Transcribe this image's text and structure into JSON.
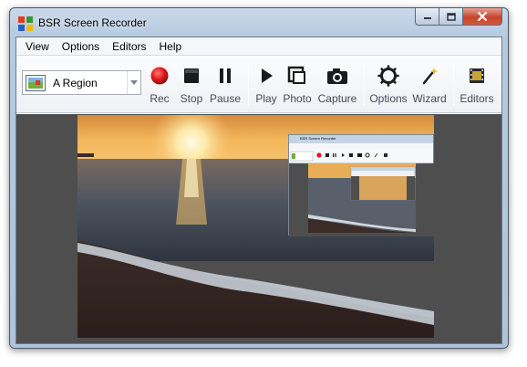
{
  "window": {
    "title": "BSR Screen Recorder"
  },
  "menu": [
    {
      "label": "View"
    },
    {
      "label": "Options"
    },
    {
      "label": "Editors"
    },
    {
      "label": "Help"
    }
  ],
  "region_select": {
    "value": "A Region",
    "icon": "region-icon"
  },
  "toolbar": {
    "rec": {
      "label": "Rec",
      "icon": "record-icon",
      "color": "#e11a1a"
    },
    "stop": {
      "label": "Stop",
      "icon": "stop-icon"
    },
    "pause": {
      "label": "Pause",
      "icon": "pause-icon"
    },
    "play": {
      "label": "Play",
      "icon": "play-icon"
    },
    "photo": {
      "label": "Photo",
      "icon": "photo-icon"
    },
    "capture": {
      "label": "Capture",
      "icon": "camera-icon"
    },
    "options": {
      "label": "Options",
      "icon": "gear-icon"
    },
    "wizard": {
      "label": "Wizard",
      "icon": "wand-icon"
    },
    "editors": {
      "label": "Editors",
      "icon": "film-icon"
    }
  },
  "mini_window": {
    "title": "BSR Screen Recorder",
    "menu_text": "View  Options  Editors  Help",
    "region_value": "A Region"
  },
  "colors": {
    "record_red": "#e11a1a",
    "preview_background": "#4e4e4e",
    "close_button": "#c7442b"
  }
}
